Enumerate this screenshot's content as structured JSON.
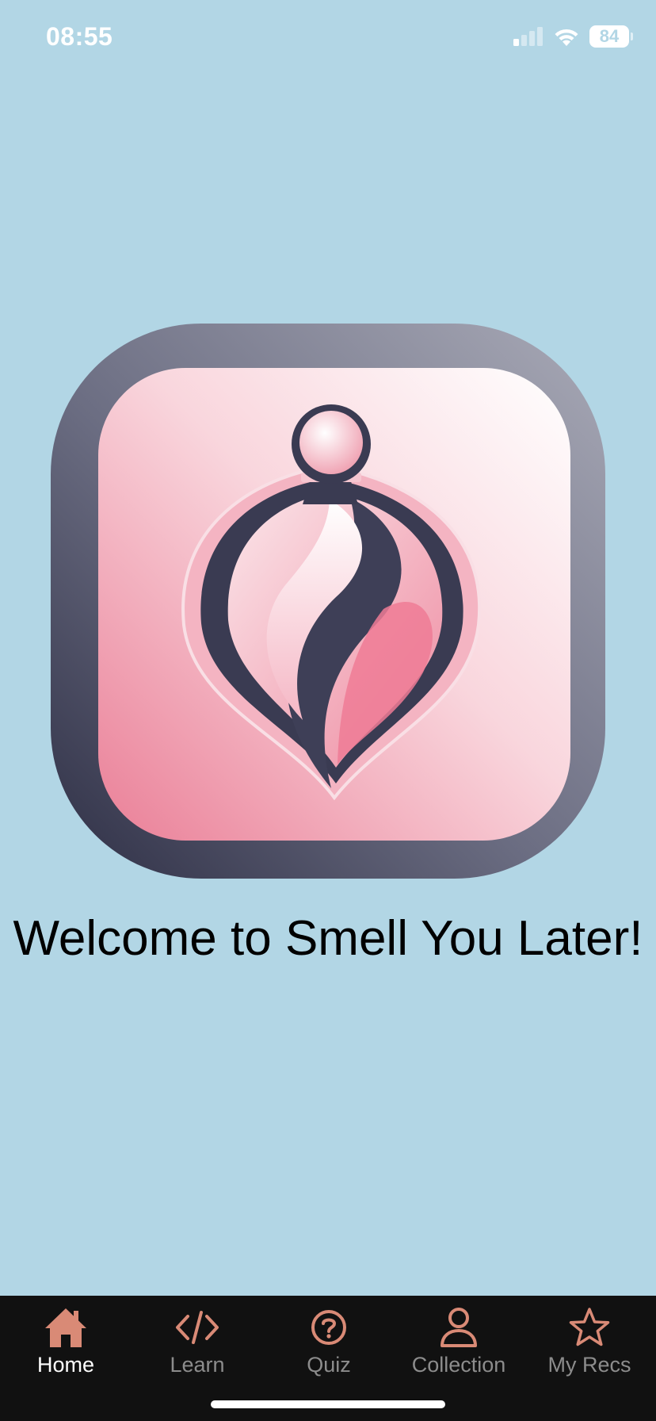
{
  "status_bar": {
    "time": "08:55",
    "battery_level": "84",
    "signal_icon": "cellular-signal-icon",
    "wifi_icon": "wifi-icon"
  },
  "main": {
    "logo_icon": "perfume-bottle-logo-icon",
    "welcome_text": "Welcome to Smell You Later!"
  },
  "tab_bar": {
    "tabs": [
      {
        "label": "Home",
        "icon": "home-icon",
        "active": true
      },
      {
        "label": "Learn",
        "icon": "code-icon",
        "active": false
      },
      {
        "label": "Quiz",
        "icon": "question-circle-icon",
        "active": false
      },
      {
        "label": "Collection",
        "icon": "user-icon",
        "active": false
      },
      {
        "label": "My Recs",
        "icon": "star-icon",
        "active": false
      }
    ]
  },
  "colors": {
    "background": "#b2d6e5",
    "tab_bar": "#111111",
    "tab_icon": "#d98a76",
    "tab_label_inactive": "#8c8c8c",
    "tab_label_active": "#ffffff",
    "logo_pink": "#f2a3b3",
    "logo_dark": "#3a3b52"
  }
}
